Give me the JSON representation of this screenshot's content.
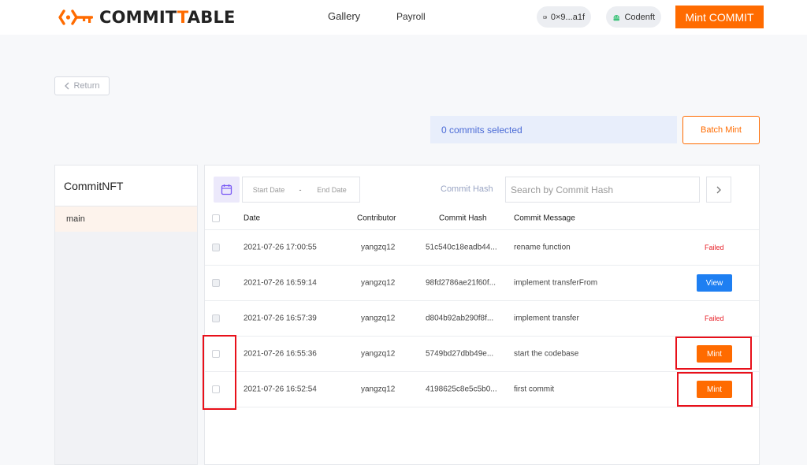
{
  "brand": {
    "name_prefix": "COMMIT",
    "name_highlight": "T",
    "name_suffix": "ABLE",
    "accent": "#ff6b00"
  },
  "nav": {
    "gallery": "Gallery",
    "payroll": "Payroll"
  },
  "header": {
    "wallet": "0×9...a1f",
    "user": "Codenft",
    "mint_commit": "Mint COMMIT"
  },
  "back": {
    "label": "Return"
  },
  "selection": {
    "text": "0 commits selected",
    "batch_mint": "Batch Mint"
  },
  "sidebar": {
    "title": "CommitNFT",
    "items": [
      {
        "label": "main"
      }
    ]
  },
  "filters": {
    "start_placeholder": "Start Date",
    "separator": "-",
    "end_placeholder": "End Date",
    "hash_label": "Commit Hash",
    "hash_placeholder": "Search by Commit Hash"
  },
  "table": {
    "columns": [
      "Date",
      "Contributor",
      "Commit Hash",
      "Commit Message"
    ],
    "rows": [
      {
        "date": "2021-07-26 17:00:55",
        "contributor": "yangzq12",
        "hash": "51c540c18eadb44...",
        "message": "rename function",
        "status": "Failed"
      },
      {
        "date": "2021-07-26 16:59:14",
        "contributor": "yangzq12",
        "hash": "98fd2786ae21f60f...",
        "message": "implement transferFrom",
        "status": "View"
      },
      {
        "date": "2021-07-26 16:57:39",
        "contributor": "yangzq12",
        "hash": "d804b92ab290f8f...",
        "message": "implement transfer",
        "status": "Failed"
      },
      {
        "date": "2021-07-26 16:55:36",
        "contributor": "yangzq12",
        "hash": "5749bd27dbb49e...",
        "message": "start the codebase",
        "status": "Mint"
      },
      {
        "date": "2021-07-26 16:52:54",
        "contributor": "yangzq12",
        "hash": "4198625c8e5c5b0...",
        "message": "first commit",
        "status": "Mint"
      }
    ]
  },
  "colors": {
    "failed": "#e8222a",
    "view": "#1e7ff2",
    "mint": "#ff6b00",
    "highlight_box": "#e8101a"
  }
}
